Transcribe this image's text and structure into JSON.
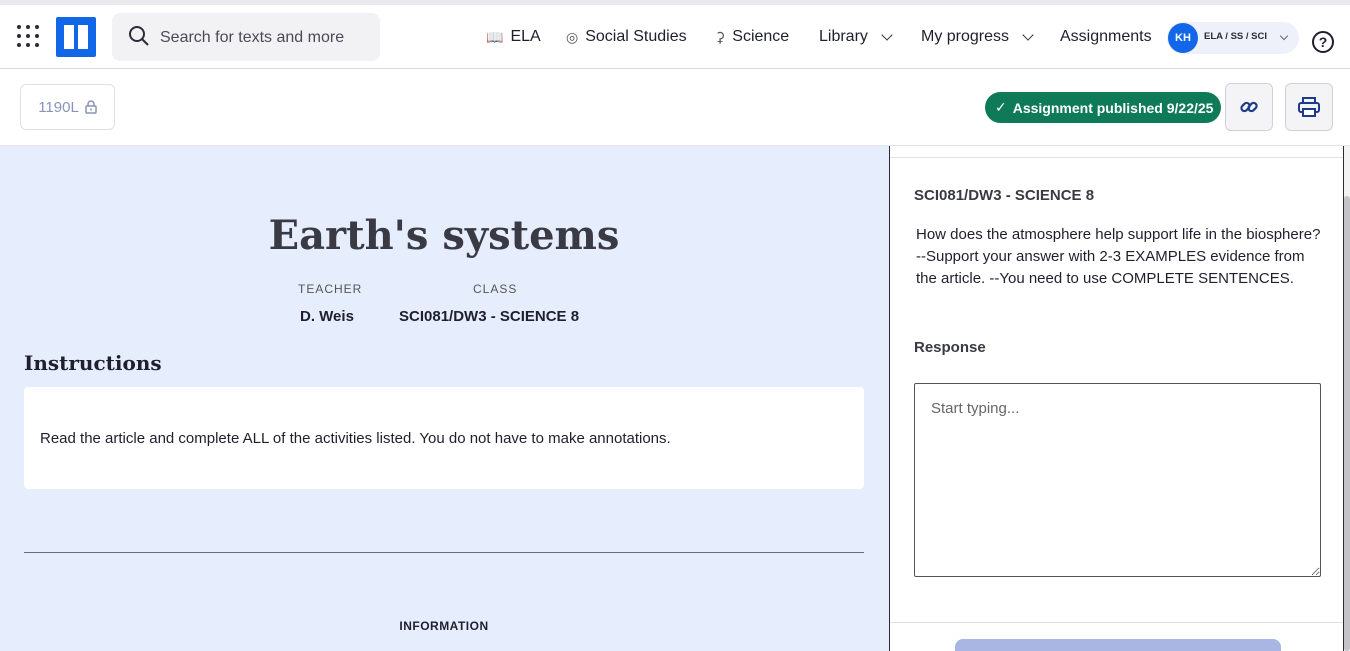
{
  "header": {
    "search_placeholder": "Search for texts and more",
    "nav": [
      {
        "label": "ELA",
        "icon": "book-icon"
      },
      {
        "label": "Social Studies",
        "icon": "globe-icon"
      },
      {
        "label": "Science",
        "icon": "flask-icon"
      },
      {
        "label": "Library",
        "icon": "chevron-down-icon"
      },
      {
        "label": "My progress",
        "icon": "chevron-down-icon"
      },
      {
        "label": "Assignments"
      }
    ],
    "user": {
      "initials": "KH",
      "classes": "ELA / SS / SCI"
    },
    "help_symbol": "?"
  },
  "toolbar": {
    "lexile": "1190L",
    "published_label": "Assignment published 9/22/25",
    "accent_color": "#0f7a57"
  },
  "article": {
    "title": "Earth's systems",
    "teacher_label": "TEACHER",
    "teacher_value": "D. Weis",
    "class_label": "CLASS",
    "class_value": "SCI081/DW3 - SCIENCE 8",
    "instructions_heading": "Instructions",
    "instructions_text": "Read the article and complete ALL of the activities listed. You do not have to make annotations.",
    "info_label": "INFORMATION"
  },
  "panel": {
    "class_name": "SCI081/DW3 - SCIENCE 8",
    "question": "How does the atmosphere help support life in the biosphere? --Support your answer with 2-3 EXAMPLES evidence from the article. --You need to use COMPLETE SENTENCES.",
    "response_label": "Response",
    "response_placeholder": "Start typing...",
    "response_value": ""
  }
}
